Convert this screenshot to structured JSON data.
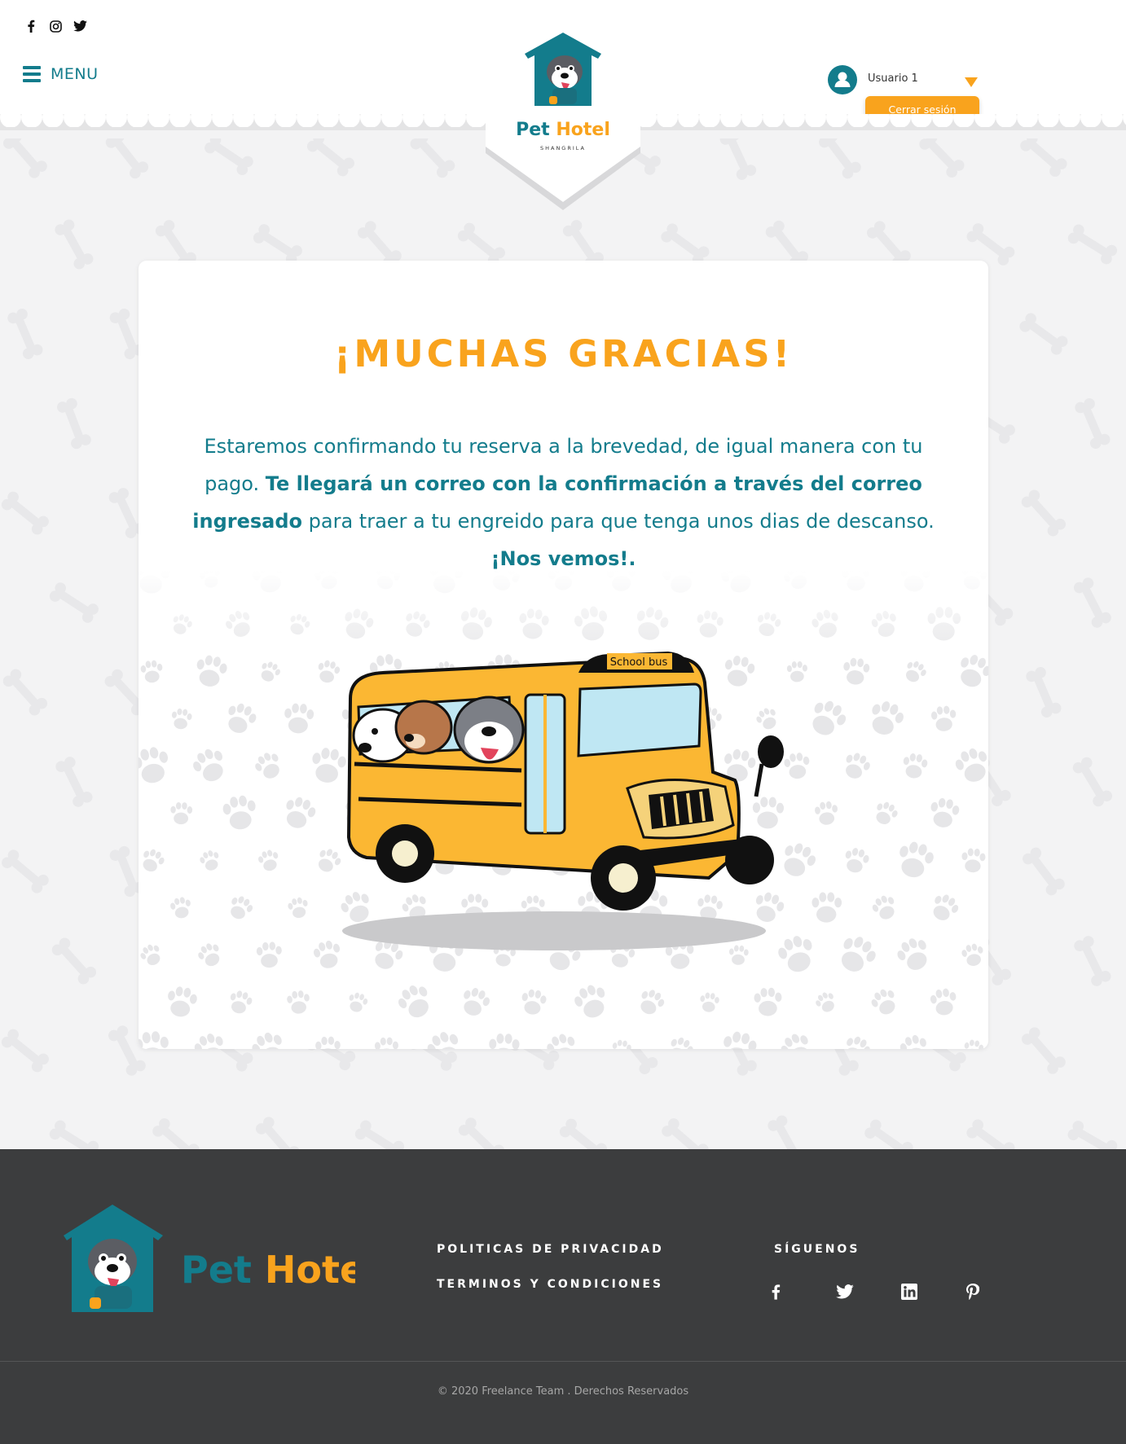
{
  "header": {
    "social_icons": [
      "facebook-icon",
      "instagram-icon",
      "twitter-icon"
    ],
    "menu_label": "MENU",
    "logo": {
      "name": "Pet Hotel",
      "tagline": "SHANGRILA"
    },
    "user": {
      "name": "Usuario 1",
      "logout_label": "Cerrar sesión"
    }
  },
  "main": {
    "title": "¡MUCHAS GRACIAS!",
    "message": {
      "part1": "Estaremos confirmando tu reserva a la brevedad, de igual manera con tu pago. ",
      "bold1": "Te llegará un correo con la confirmación a través del correo ingresado",
      "part2": " para traer a tu engreido para que tenga unos dias de descanso. ",
      "bold2": "¡Nos vemos!."
    },
    "illustration": {
      "bus_sign": "School bus"
    }
  },
  "footer": {
    "logo_name": "Pet Hotel",
    "links": [
      "POLITICAS DE PRIVACIDAD",
      "TERMINOS Y CONDICIONES"
    ],
    "follow_title": "SÍGUENOS",
    "social_icons": [
      "facebook-icon",
      "twitter-icon",
      "linkedin-icon",
      "pinterest-icon"
    ],
    "copyright": "© 2020 Freelance Team . Derechos Reservados"
  },
  "colors": {
    "teal": "#137c8c",
    "orange": "#f9a31d",
    "footer_bg": "#3c3d3e",
    "page_bg": "#f3f3f4"
  }
}
